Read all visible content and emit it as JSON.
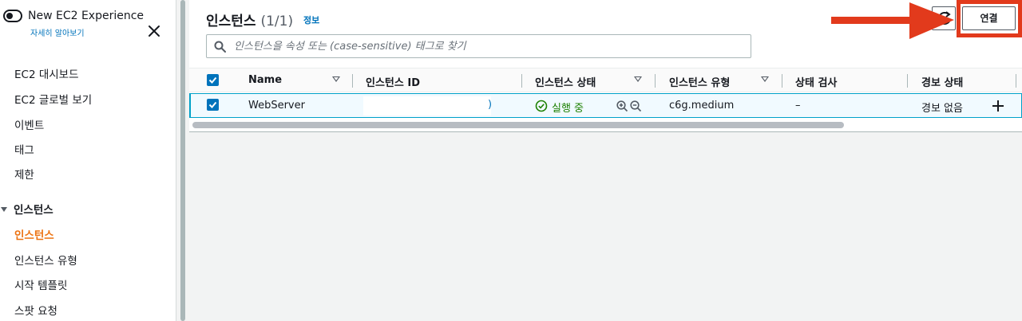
{
  "sidebar": {
    "new_experience_label": "New EC2 Experience",
    "learn_more": "자세히 알아보기",
    "items": [
      {
        "label": "EC2 대시보드"
      },
      {
        "label": "EC2 글로벌 보기"
      },
      {
        "label": "이벤트"
      },
      {
        "label": "태그"
      },
      {
        "label": "제한"
      }
    ],
    "section_label": "인스턴스",
    "sub_items": [
      {
        "label": "인스턴스",
        "active": true
      },
      {
        "label": "인스턴스 유형"
      },
      {
        "label": "시작 템플릿"
      },
      {
        "label": "스팟 요청"
      }
    ]
  },
  "panel": {
    "title": "인스턴스",
    "count": "(1/1)",
    "info_link": "정보",
    "connect_button": "연결"
  },
  "search": {
    "placeholder": "인스턴스을 속성 또는 (case-sensitive) 태그로 찾기"
  },
  "table": {
    "headers": {
      "name": "Name",
      "instance_id": "인스턴스 ID",
      "instance_state": "인스턴스 상태",
      "instance_type": "인스턴스 유형",
      "status_check": "상태 검사",
      "alarm_status": "경보 상태"
    },
    "rows": [
      {
        "name": "WebServer",
        "instance_id_suffix": ")",
        "state": "실행 중",
        "type": "c6g.medium",
        "status_check": "–",
        "alarm_status": "경보 없음"
      }
    ]
  },
  "colors": {
    "accent_orange": "#ec7211",
    "link_blue": "#0073bb",
    "running_green": "#1d8102",
    "annotation_red": "#e23a1c"
  }
}
